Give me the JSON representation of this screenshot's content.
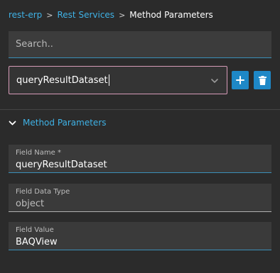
{
  "breadcrumb": {
    "items": [
      "rest-erp",
      "Rest Services"
    ],
    "separator": ">",
    "current": "Method Parameters"
  },
  "search": {
    "placeholder": "Search..",
    "value": ""
  },
  "selector": {
    "value": "queryResultDataset",
    "icon": "chevron-down-icon"
  },
  "actions": {
    "add_icon": "plus-icon",
    "delete_icon": "trash-icon"
  },
  "section": {
    "title": "Method Parameters",
    "expanded": true,
    "icon": "chevron-down-icon"
  },
  "fields": [
    {
      "label": "Field Name *",
      "value": "queryResultDataset"
    },
    {
      "label": "Field Data Type",
      "value": "object"
    },
    {
      "label": "Field Value",
      "value": "BAQView"
    }
  ],
  "colors": {
    "accent": "#3fb2e6",
    "button": "#1e88c7",
    "background": "#2b2b2b",
    "focus_border": "#d79bb8"
  }
}
